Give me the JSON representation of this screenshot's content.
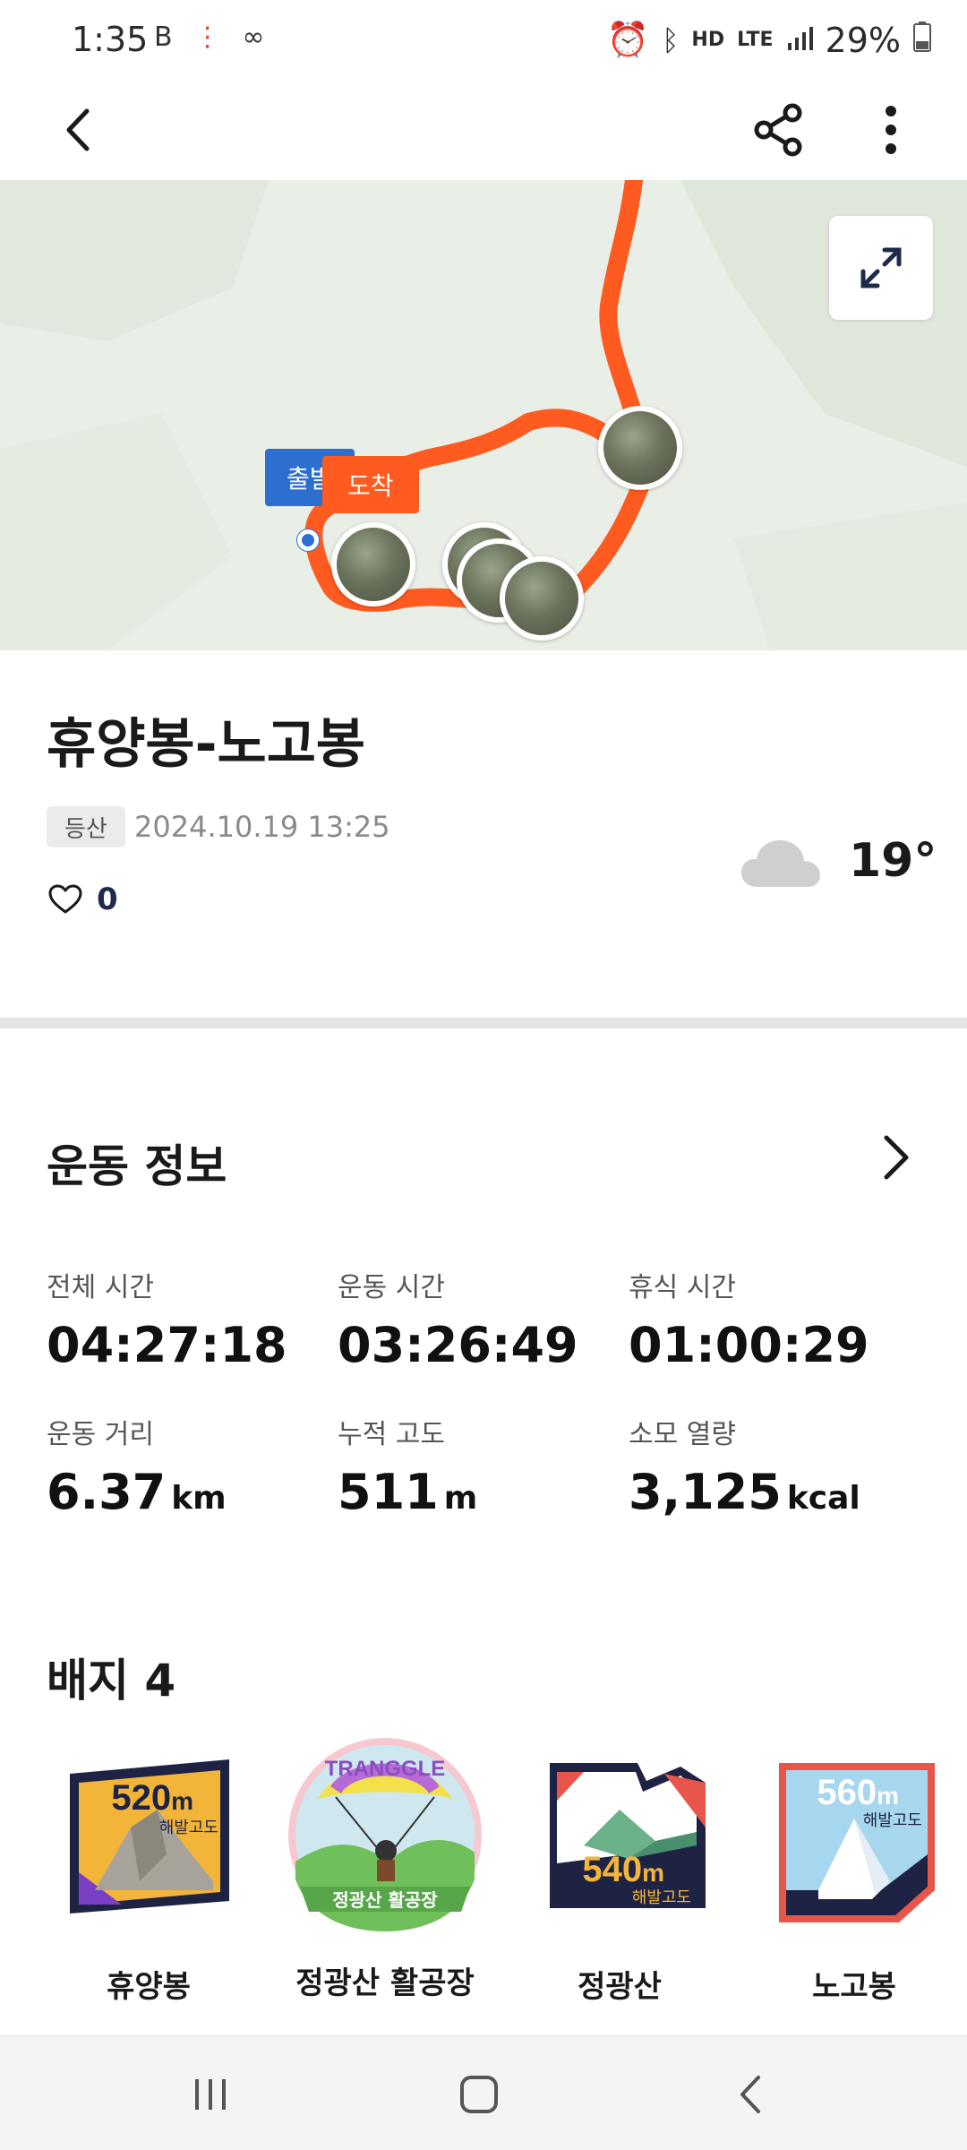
{
  "status_bar": {
    "time": "1:35",
    "network_label": "LTE",
    "battery": "29%"
  },
  "map": {
    "start_label": "출발",
    "end_label": "도착"
  },
  "activity": {
    "title": "휴양봉-노고봉",
    "tag": "등산",
    "datetime": "2024.10.19 13:25",
    "likes": "0",
    "weather_icon": "cloud-icon",
    "temperature": "19°"
  },
  "exercise_info": {
    "section_title": "운동 정보",
    "stats": [
      {
        "label": "전체 시간",
        "value": "04:27:18",
        "unit": ""
      },
      {
        "label": "운동 시간",
        "value": "03:26:49",
        "unit": ""
      },
      {
        "label": "휴식 시간",
        "value": "01:00:29",
        "unit": ""
      },
      {
        "label": "운동 거리",
        "value": "6.37",
        "unit": "km"
      },
      {
        "label": "누적 고도",
        "value": "511",
        "unit": "m"
      },
      {
        "label": "소모 열량",
        "value": "3,125",
        "unit": "kcal"
      }
    ]
  },
  "badges": {
    "section_title": "배지 4",
    "items": [
      {
        "name": "휴양봉",
        "altitude": "520",
        "unit": "m",
        "caption": "해발고도"
      },
      {
        "name": "정광산 활공장",
        "arc_text": "TRANGGLE",
        "ribbon_text": "정광산 활공장"
      },
      {
        "name": "정광산",
        "altitude": "540",
        "unit": "m",
        "caption": "해발고도"
      },
      {
        "name": "노고봉",
        "altitude": "560",
        "unit": "m",
        "caption": "해발고도"
      }
    ]
  },
  "colors": {
    "route": "#ff5a1f",
    "start_pin": "#2c6fd1",
    "badge_navy": "#1e2344"
  }
}
